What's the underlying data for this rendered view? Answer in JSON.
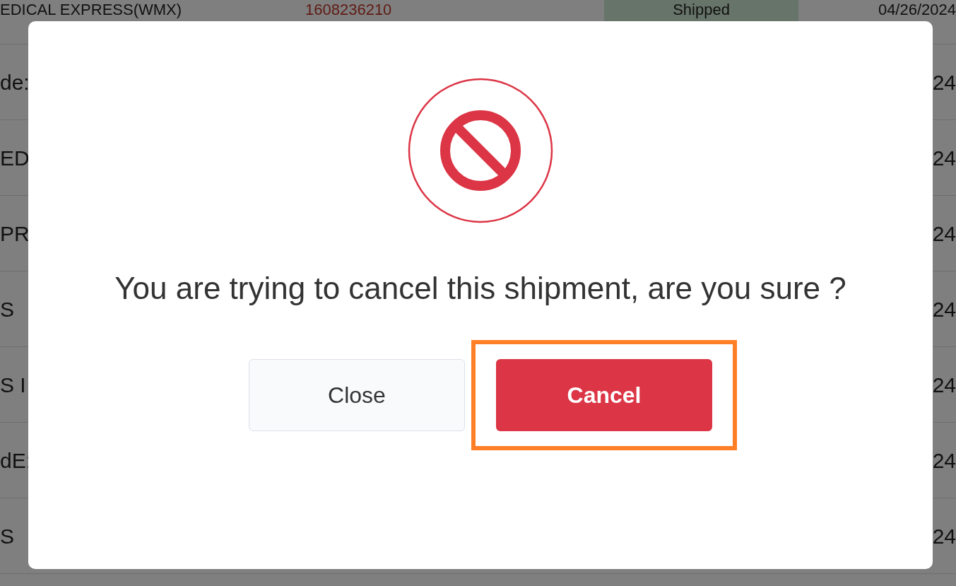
{
  "table": {
    "rows": [
      {
        "carrier": "EDICAL EXPRESS(WMX)",
        "tracking": "1608236210",
        "status": "Shipped",
        "date": "04/26/2024"
      },
      {
        "carrier": "de:",
        "date": "24"
      },
      {
        "carrier": "ED",
        "date": "24"
      },
      {
        "carrier": "PR",
        "date": "24"
      },
      {
        "carrier": "S",
        "date": "24"
      },
      {
        "carrier": "S I",
        "date": "24"
      },
      {
        "carrier": "dE:",
        "date": "24"
      },
      {
        "carrier": "S",
        "date": "24"
      }
    ]
  },
  "dialog": {
    "message": "You are trying to cancel this shipment, are you sure ?",
    "buttons": [
      {
        "label": "Close",
        "kind": "secondary",
        "highlighted": false
      },
      {
        "label": "Cancel",
        "kind": "danger",
        "highlighted": true
      }
    ]
  }
}
